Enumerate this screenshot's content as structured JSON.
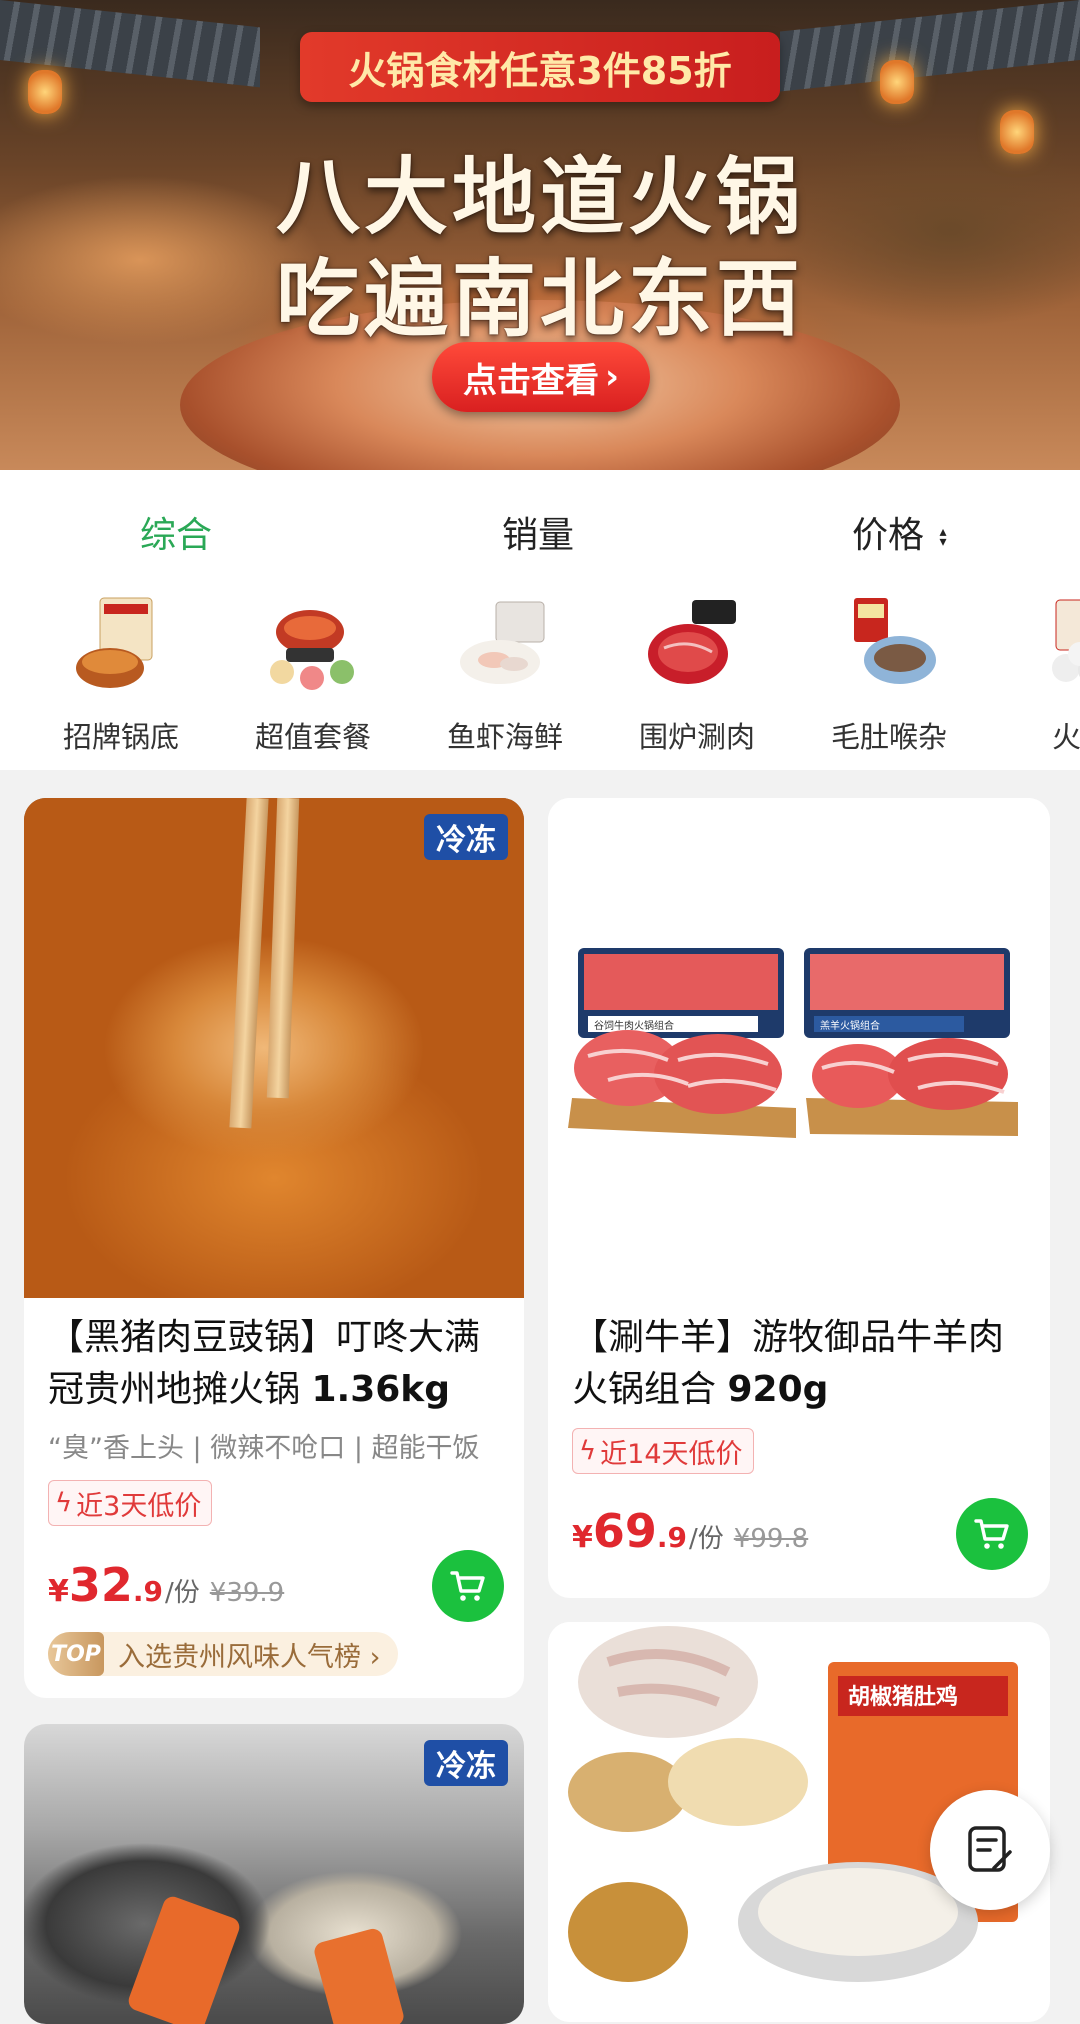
{
  "banner": {
    "promo_tag": "火锅食材任意3件85折",
    "headline_line1": "八大地道火锅",
    "headline_line2": "吃遍南北东西",
    "cta": "点击查看"
  },
  "sort_tabs": [
    {
      "label": "综合",
      "active": true
    },
    {
      "label": "销量",
      "active": false
    },
    {
      "label": "价格",
      "active": false
    }
  ],
  "categories": [
    {
      "label": "招牌锅底",
      "icon": "hotpot-base-icon"
    },
    {
      "label": "超值套餐",
      "icon": "combo-meal-icon"
    },
    {
      "label": "鱼虾海鲜",
      "icon": "seafood-icon"
    },
    {
      "label": "围炉涮肉",
      "icon": "sliced-meat-icon"
    },
    {
      "label": "毛肚喉杂",
      "icon": "tripe-icon"
    },
    {
      "label": "火锅",
      "icon": "hotpot-balls-icon"
    }
  ],
  "products": [
    {
      "badge": "冷冻",
      "title": "【黑猪肉豆豉锅】叮咚大满冠贵州地摊火锅",
      "weight": "1.36kg",
      "subtitle": "“臭”香上头 | 微辣不呛口 | 超能干饭",
      "tag": "近3天低价",
      "currency": "¥",
      "price_int": "32",
      "price_dec": ".9",
      "unit": "/份",
      "orig_price": "¥39.9",
      "rank_badge": "TOP",
      "rank_text": "入选贵州风味人气榜 ›"
    },
    {
      "title": "【涮牛羊】游牧御品牛羊肉火锅组合",
      "weight": "920g",
      "tag": "近14天低价",
      "currency": "¥",
      "price_int": "69",
      "price_dec": ".9",
      "unit": "/份",
      "orig_price": "¥99.8",
      "box_label_left": "谷饲牛肉火锅组合",
      "box_label_right": "羔羊火锅组合"
    },
    {
      "badge": "冷冻"
    },
    {
      "box_label": "胡椒猪肚鸡"
    }
  ],
  "colors": {
    "accent_green": "#2aa856",
    "cart_green": "#1bc13e",
    "price_red": "#e0282e",
    "frozen_blue": "#1f4fa6"
  }
}
